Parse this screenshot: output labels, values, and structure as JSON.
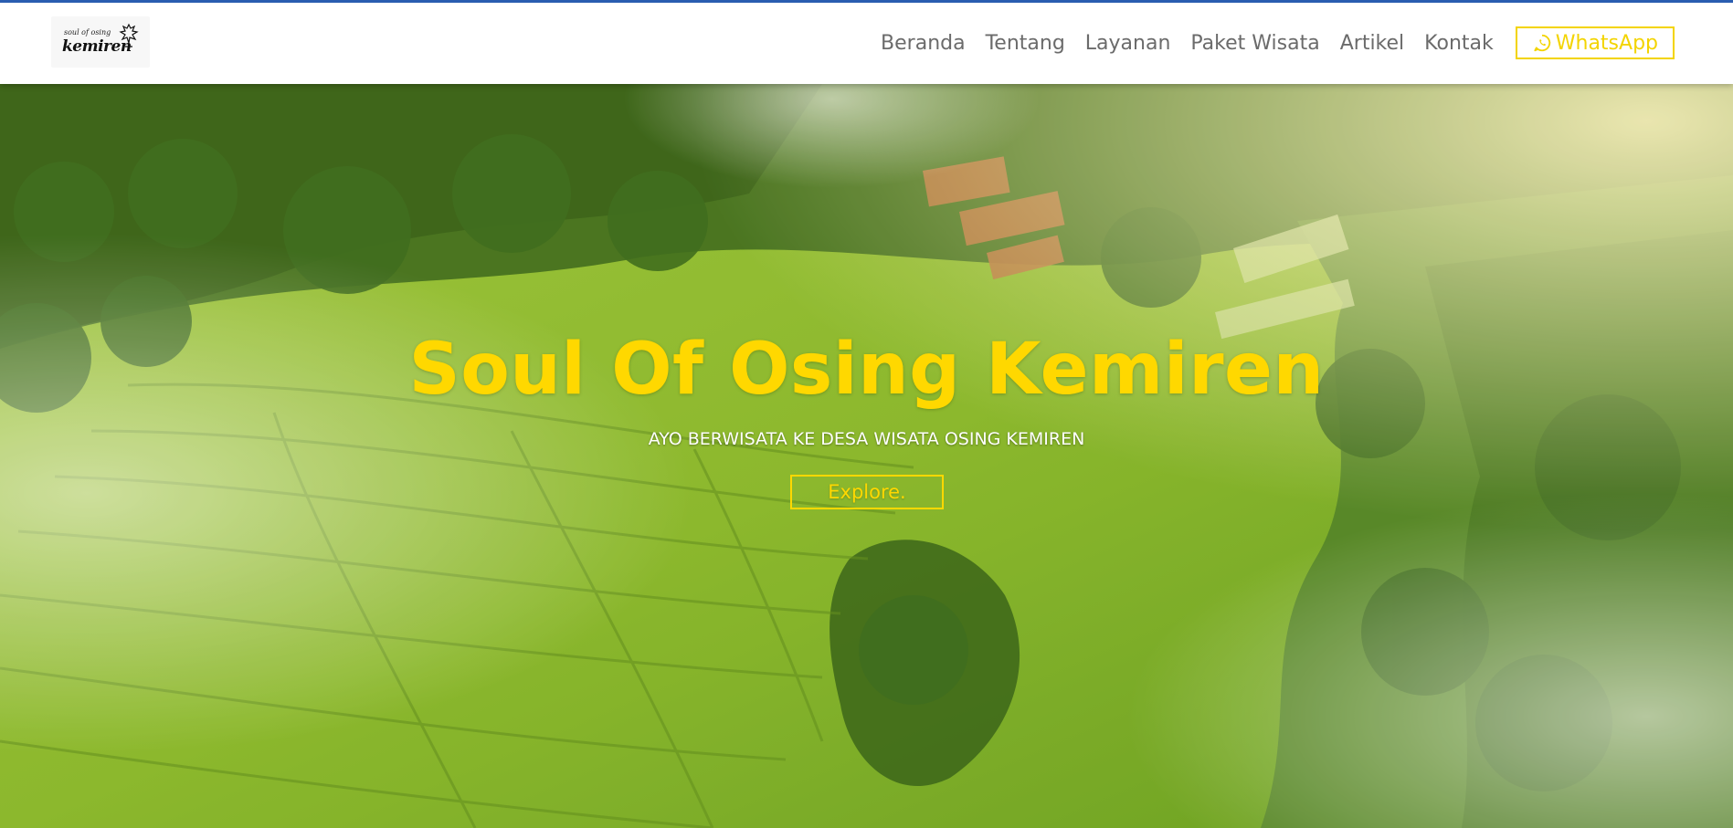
{
  "nav": {
    "logo_alt": "soul of osing kemiren",
    "logo_small_text": "soul of osing",
    "logo_big_text": "kemiren",
    "links": [
      {
        "label": "Beranda"
      },
      {
        "label": "Tentang"
      },
      {
        "label": "Layanan"
      },
      {
        "label": "Paket Wisata"
      },
      {
        "label": "Artikel"
      },
      {
        "label": "Kontak"
      }
    ],
    "whatsapp_label": "WhatsApp"
  },
  "hero": {
    "title": "Soul Of Osing Kemiren",
    "subtitle": "AYO BERWISATA KE DESA WISATA OSING KEMIREN",
    "button_label": "Explore."
  },
  "colors": {
    "accent_yellow": "#ffd800",
    "top_stripe": "#2a5db0",
    "nav_text": "#6b6b6b"
  },
  "icons": [
    "whatsapp-icon",
    "logo-figure-icon"
  ]
}
